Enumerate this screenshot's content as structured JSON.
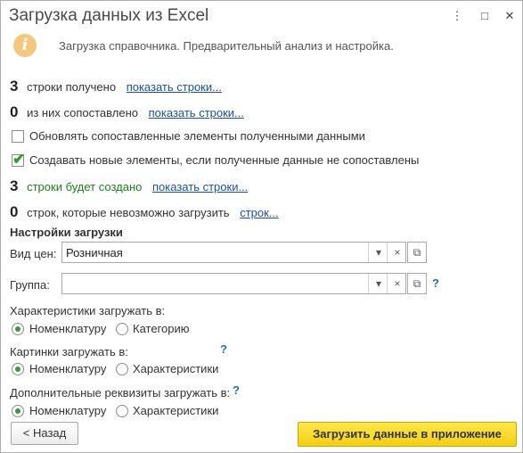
{
  "window": {
    "title": "Загрузка данных из Excel",
    "more_glyph": "⋮",
    "maximize_glyph": "□",
    "close_glyph": "✕"
  },
  "info": {
    "icon": "info-icon",
    "glyph": "i",
    "text": "Загрузка справочника. Предварительный анализ и настройка."
  },
  "stats": [
    {
      "number": "3",
      "label": "строки получено",
      "link": "показать строки..."
    },
    {
      "number": "0",
      "label": "из них сопоставлено",
      "link": "показать строки..."
    },
    {
      "number": "3",
      "label": "строки будет создано",
      "link": "показать строки..."
    },
    {
      "number": "0",
      "label": "строк, которые невозможно загрузить",
      "link": "строк..."
    }
  ],
  "options": {
    "update_existing": {
      "label": "Обновлять сопоставленные элементы полученными данными",
      "checked": false
    },
    "create_new": {
      "label": "Создавать новые элементы, если полученные данные не сопоставлены",
      "checked": true,
      "check_glyph": "✔"
    }
  },
  "settings": {
    "heading": "Настройки загрузки",
    "price_type": {
      "label": "Вид цен:",
      "value": "Розничная"
    },
    "group": {
      "label": "Группа:",
      "value": ""
    },
    "dropdown_glyph": "▾",
    "clear_glyph": "×",
    "open_glyph": "⧉",
    "help_glyph": "?"
  },
  "characteristics": {
    "label": "Характеристики загружать в:",
    "options": [
      "Номенклатуру",
      "Категорию"
    ],
    "selected": 0
  },
  "pictures": {
    "label": "Картинки загружать в:",
    "options": [
      "Номенклатуру",
      "Характеристики"
    ],
    "selected": 0
  },
  "additional": {
    "label": "Дополнительные реквизиты загружать в:",
    "options": [
      "Номенклатуру",
      "Характеристики"
    ],
    "selected": 0
  },
  "buttons": {
    "back": "< Назад",
    "load": "Загрузить данные в приложение"
  }
}
